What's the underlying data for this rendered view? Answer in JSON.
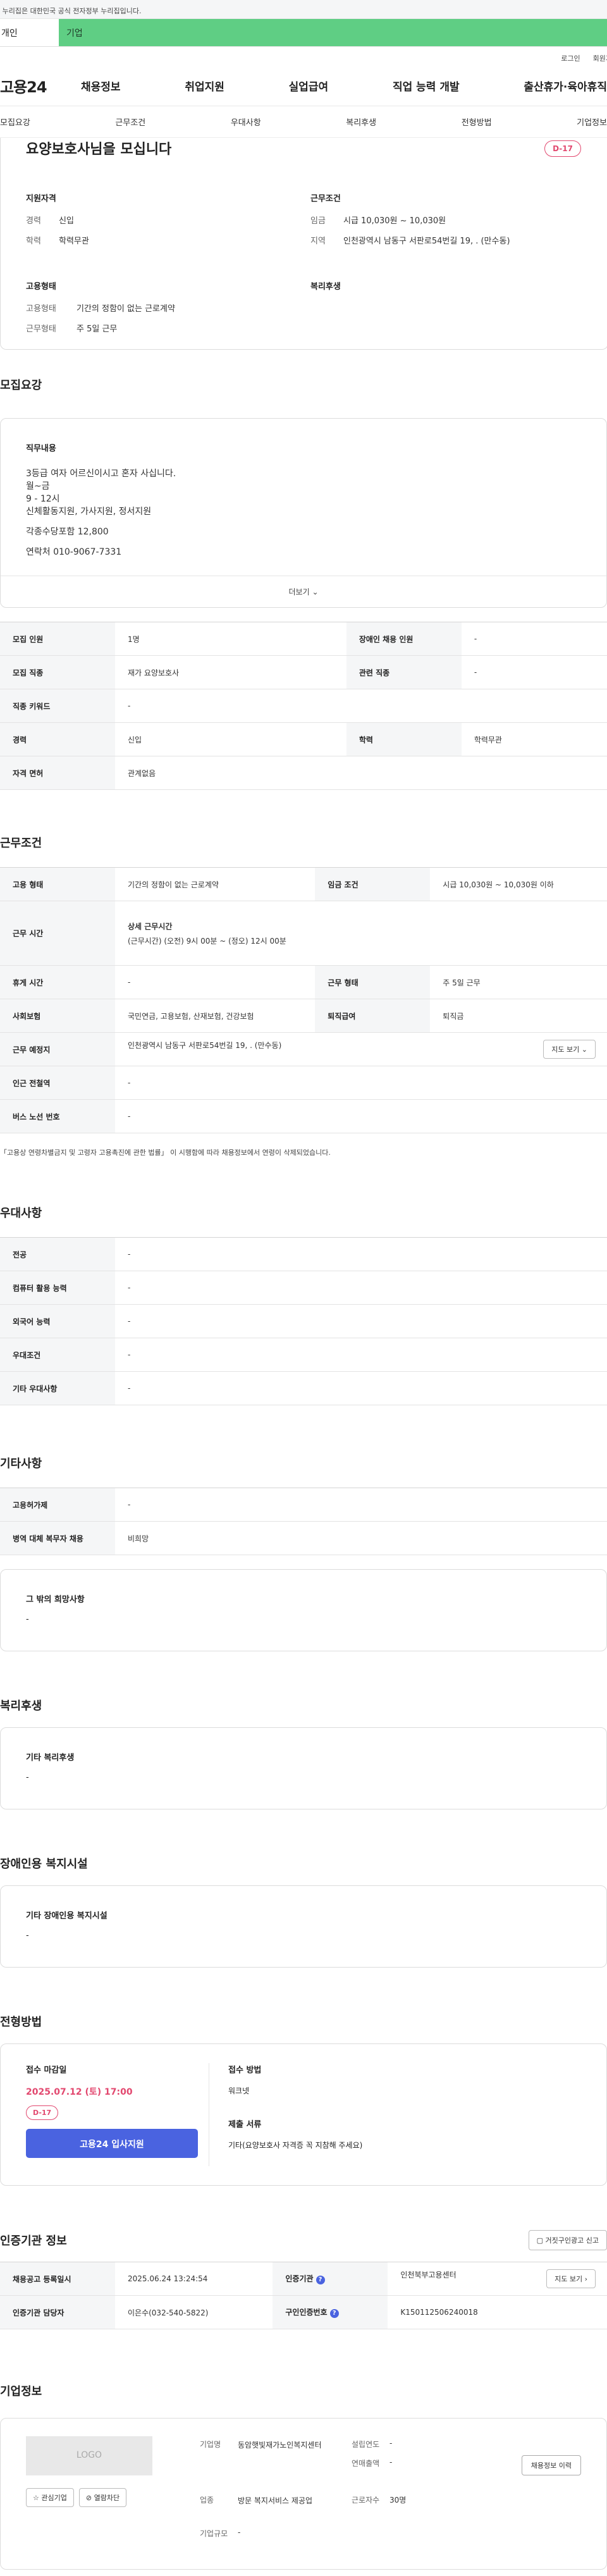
{
  "gov_banner": "이 누리집은 대한민국 공식 전자정부 누리집입니다.",
  "tabs": {
    "personal": "개인",
    "company": "기업"
  },
  "util": {
    "login": "로그인",
    "join": "회원가"
  },
  "logo": "고용24",
  "gnb": [
    "채용정보",
    "취업지원",
    "실업급여",
    "직업 능력 개발",
    "출산휴가·육아휴직"
  ],
  "anchor_nav": [
    "모집요강",
    "근무조건",
    "우대사항",
    "복리후생",
    "전형방법",
    "기업정보"
  ],
  "summary": {
    "title": "요양보호사님을 모십니다",
    "dday": "D-17",
    "qualification": {
      "head": "지원자격",
      "rows": [
        {
          "k": "경력",
          "v": "신입"
        },
        {
          "k": "학력",
          "v": "학력무관"
        }
      ]
    },
    "work": {
      "head": "근무조건",
      "rows": [
        {
          "k": "임금",
          "v": "시급 10,030원 ~ 10,030원"
        },
        {
          "k": "지역",
          "v": "인천광역시 남동구 서판로54번길 19, . (만수동)"
        }
      ]
    },
    "employment": {
      "head": "고용형태",
      "rows": [
        {
          "k": "고용형태",
          "v": "기간의 정함이 없는 근로계약"
        },
        {
          "k": "근무형태",
          "v": "주 5일 근무"
        }
      ]
    },
    "welfare": {
      "head": "복리후생"
    }
  },
  "recruit": {
    "title": "모집요강",
    "job_head": "직무내용",
    "lines": [
      "3등급 여자 어르신이시고 혼자 사십니다.",
      "월~금",
      "9 - 12시",
      "신체활동지원, 가사지원, 정서지원",
      "",
      "각종수당포함 12,800",
      "",
      "연락처 010-9067-7331"
    ],
    "more": "더보기",
    "table": [
      [
        {
          "k": "모집 인원",
          "v": "1명"
        },
        {
          "k": "장애인 채용 인원",
          "v": "-"
        }
      ],
      [
        {
          "k": "모집 직종",
          "v": "재가 요양보호사"
        },
        {
          "k": "관련 직종",
          "v": "-"
        }
      ],
      [
        {
          "k": "직종 키워드",
          "v": "-"
        }
      ],
      [
        {
          "k": "경력",
          "v": "신입"
        },
        {
          "k": "학력",
          "v": "학력무관"
        }
      ],
      [
        {
          "k": "자격 면허",
          "v": "관계없음"
        }
      ]
    ]
  },
  "conditions": {
    "title": "근무조건",
    "emp_type_k": "고용 형태",
    "emp_type_v": "기간의 정함이 없는 근로계약",
    "wage_k": "임금 조건",
    "wage_v": "시급 10,030원 ~ 10,030원 이하",
    "hours_k": "근무 시간",
    "hours_head": "상세 근무시간",
    "hours_v": "(근무시간) (오전) 9시 00분 ~ (정오) 12시 00분",
    "rest_k": "휴게 시간",
    "rest_v": "-",
    "form_k": "근무 형태",
    "form_v": "주 5일 근무",
    "ins_k": "사회보험",
    "ins_v": "국민연금, 고용보험, 산재보험, 건강보험",
    "sev_k": "퇴직급여",
    "sev_v": "퇴직금",
    "place_k": "근무 예정지",
    "place_v": "인천광역시 남동구 서판로54번길 19, . (만수동)",
    "map_btn": "지도 보기",
    "subway_k": "인근 전철역",
    "subway_v": "-",
    "bus_k": "버스 노선 번호",
    "bus_v": "-",
    "note": "「고용상 연령차별금지 및 고령자 고용촉진에 관한 법률」 이 시행함에 따라 채용정보에서 연령이 삭제되었습니다."
  },
  "preferences": {
    "title": "우대사항",
    "rows": [
      {
        "k": "전공",
        "v": "-"
      },
      {
        "k": "컴퓨터 활용 능력",
        "v": "-"
      },
      {
        "k": "외국어 능력",
        "v": "-"
      },
      {
        "k": "우대조건",
        "v": "-"
      },
      {
        "k": "기타 우대사항",
        "v": "-"
      }
    ]
  },
  "other": {
    "title": "기타사항",
    "rows": [
      {
        "k": "고용허가제",
        "v": "-"
      },
      {
        "k": "병역 대체 복무자 채용",
        "v": "비희망"
      }
    ],
    "box_head": "그 밖의 희망사항",
    "box_v": "-"
  },
  "welfare": {
    "title": "복리후생",
    "box_head": "기타 복리후생",
    "box_v": "-"
  },
  "disability": {
    "title": "장애인용 복지시설",
    "box_head": "기타 장애인용 복지시설",
    "box_v": "-"
  },
  "screening": {
    "title": "전형방법",
    "deadline_head": "접수 마감일",
    "deadline": "2025.07.12 (토) 17:00",
    "dday": "D-17",
    "apply_btn": "고용24 입사지원",
    "method_head": "접수 방법",
    "method_v": "워크넷",
    "docs_head": "제출 서류",
    "docs_v": "기타(요양보호사 자격증 꼭 지참해 주세요)"
  },
  "agency": {
    "title": "인증기관 정보",
    "report_btn": "거짓구인광고 신고",
    "reg_k": "채용공고 등록일시",
    "reg_v": "2025.06.24 13:24:54",
    "org_k": "인증기관",
    "org_v": "인천북부고용센터",
    "map_btn": "지도 보기",
    "staff_k": "인증기관 담당자",
    "staff_v": "이은수(032-540-5822)",
    "id_k": "구인인증번호",
    "id_v": "K150112506240018"
  },
  "company": {
    "title": "기업정보",
    "logo": "LOGO",
    "fav_btn": "관심기업",
    "block_btn": "열람차단",
    "history_btn": "채용정보 이력",
    "name_k": "기업명",
    "name_v": "동암햇빛재가노인복지센터",
    "year_k": "설립연도",
    "year_v": "-",
    "sales_k": "연매출액",
    "sales_v": "-",
    "ind_k": "업종",
    "ind_v": "방문 복지서비스 제공업",
    "emp_k": "근로자수",
    "emp_v": "30명",
    "size_k": "기업규모",
    "size_v": "-"
  }
}
